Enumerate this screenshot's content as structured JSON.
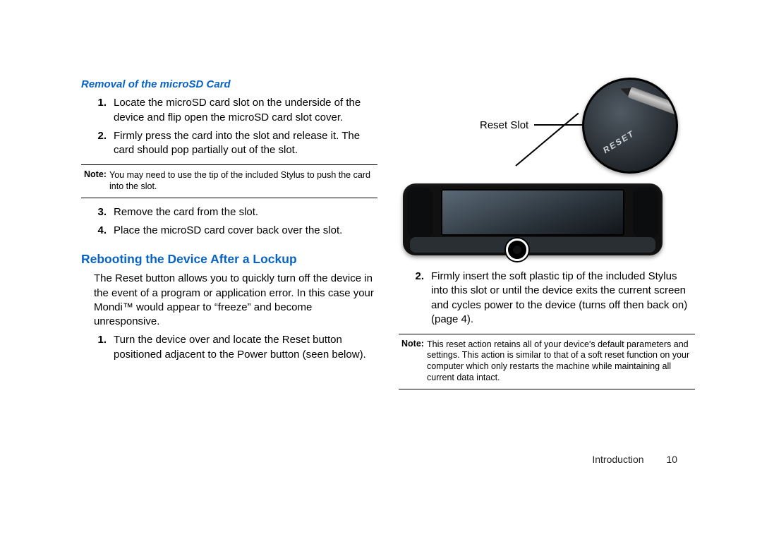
{
  "left": {
    "subheading": "Removal of the microSD Card",
    "steps_a": [
      {
        "num": "1.",
        "text": "Locate the microSD card slot on the underside of the device and flip open the microSD card slot cover."
      },
      {
        "num": "2.",
        "text": "Firmly press the card into the slot and release it. The card should pop partially out of the slot."
      }
    ],
    "note1_label": "Note:",
    "note1_body": "You may need to use the tip of the included Stylus to push the card into the slot.",
    "steps_b": [
      {
        "num": "3.",
        "text": "Remove the card from the slot."
      },
      {
        "num": "4.",
        "text": "Place the microSD card cover back over the slot."
      }
    ],
    "heading": "Rebooting the Device After a Lockup",
    "para": "The Reset button allows you to quickly turn off the device in the event of a program or application error. In this case your Mondi™ would appear to “freeze” and become unresponsive.",
    "steps_c": [
      {
        "num": "1.",
        "text": "Turn the device over and locate the Reset button positioned adjacent to the Power button (seen below)."
      }
    ]
  },
  "right": {
    "reset_label": "Reset Slot",
    "zoom_text": "RESET",
    "steps": [
      {
        "num": "2.",
        "text": "Firmly insert the soft plastic tip of the included Stylus into this slot or until the device exits the current screen and cycles power to the device (turns off then back on) (page 4)."
      }
    ],
    "note_label": "Note:",
    "note_body": "This reset action retains all of your device's default parameters and settings. This action is similar to that of a soft reset function on your computer which only restarts the machine while maintaining all current data intact."
  },
  "footer": {
    "section": "Introduction",
    "page": "10"
  }
}
